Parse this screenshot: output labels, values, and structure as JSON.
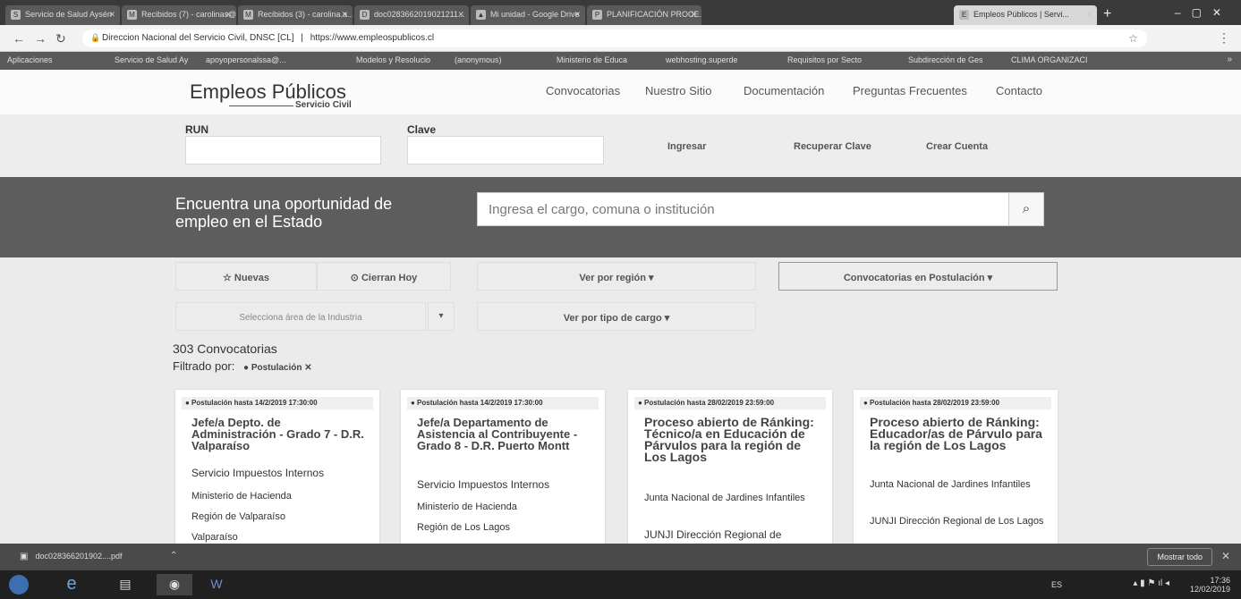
{
  "browser": {
    "tabs": [
      {
        "label": "Servicio de Salud Aysén",
        "icon": "S"
      },
      {
        "label": "Recibidos (7) - carolinas@...",
        "icon": "M"
      },
      {
        "label": "Recibidos (3) - carolina.a...",
        "icon": "M"
      },
      {
        "label": "doc0283662019021211...",
        "icon": "D"
      },
      {
        "label": "Mi unidad - Google Drive",
        "icon": "▲"
      },
      {
        "label": "PLANIFICACIÓN PROCE...",
        "icon": "P"
      },
      {
        "label": "Empleos Públicos | Servi...",
        "icon": "E"
      }
    ],
    "new_tab": "+",
    "address": {
      "site_name": "Direccion Nacional del Servicio Civil, DNSC [CL]",
      "separator": "|",
      "url": "https://www.empleospublicos.cl"
    },
    "bookmarks": [
      "Aplicaciones",
      "Servicio de Salud Ay",
      "apoyopersonalssa@...",
      "Modelos y Resolucio",
      "(anonymous)",
      "Ministerio de Educa",
      "webhosting.superde",
      "Requisitos por Secto",
      "Subdirección de Ges",
      "CLIMA ORGANIZACI"
    ]
  },
  "site": {
    "logo_main": "Empleos Públicos",
    "logo_sub": "Servicio Civil",
    "nav": [
      "Convocatorias",
      "Nuestro Sitio",
      "Documentación",
      "Preguntas Frecuentes",
      "Contacto"
    ]
  },
  "login": {
    "run_label": "RUN",
    "clave_label": "Clave",
    "ingresar": "Ingresar",
    "recuperar": "Recuperar Clave",
    "crear": "Crear Cuenta"
  },
  "hero": {
    "text": "Encuentra una oportunidad de empleo en el Estado",
    "search_placeholder": "Ingresa el cargo, comuna o institución"
  },
  "filters": {
    "nuevas": "☆ Nuevas",
    "cierran_hoy": "⊙ Cierran Hoy",
    "region": "Ver por región ▾",
    "convocatorias": "Convocatorias en Postulación ▾",
    "industria": "Selecciona área de la Industria",
    "industria_caret": "▾",
    "tipo_cargo": "Ver por tipo de cargo ▾"
  },
  "results": {
    "count": "303 Convocatorias",
    "filtered_label": "Filtrado por:",
    "filter_tag": "● Postulación ✕"
  },
  "cards": [
    {
      "date": "● Postulación hasta 14/2/2019 17:30:00",
      "title": "Jefe/a Depto. de Administración - Grado 7 - D.R. Valparaíso",
      "institution": "Servicio Impuestos Internos",
      "ministry": "Ministerio de Hacienda",
      "region": "Región de Valparaíso",
      "city": "Valparaíso"
    },
    {
      "date": "● Postulación hasta 14/2/2019 17:30:00",
      "title": "Jefe/a Departamento de Asistencia al Contribuyente - Grado 8 - D.R. Puerto Montt",
      "institution": "Servicio Impuestos Internos",
      "ministry": "Ministerio de Hacienda",
      "region": "Región de Los Lagos",
      "city": ""
    },
    {
      "date": "● Postulación hasta 28/02/2019 23:59:00",
      "title": "Proceso abierto de Ránking: Técnico/a en Educación de Párvulos para la región de Los Lagos",
      "institution": "Junta Nacional de Jardines Infantiles",
      "ministry": "JUNJI Dirección Regional de",
      "region": "",
      "city": ""
    },
    {
      "date": "● Postulación hasta 28/02/2019 23:59:00",
      "title": "Proceso abierto de Ránking: Educador/as de Párvulo para la región de Los Lagos",
      "institution": "Junta Nacional de Jardines Infantiles",
      "ministry": "JUNJI Dirección Regional de Los Lagos",
      "region": "",
      "city": ""
    }
  ],
  "download_bar": {
    "file": "doc028366201902....pdf",
    "show_all": "Mostrar todo"
  },
  "taskbar": {
    "lang": "ES",
    "time": "17:36",
    "date": "12/02/2019"
  }
}
